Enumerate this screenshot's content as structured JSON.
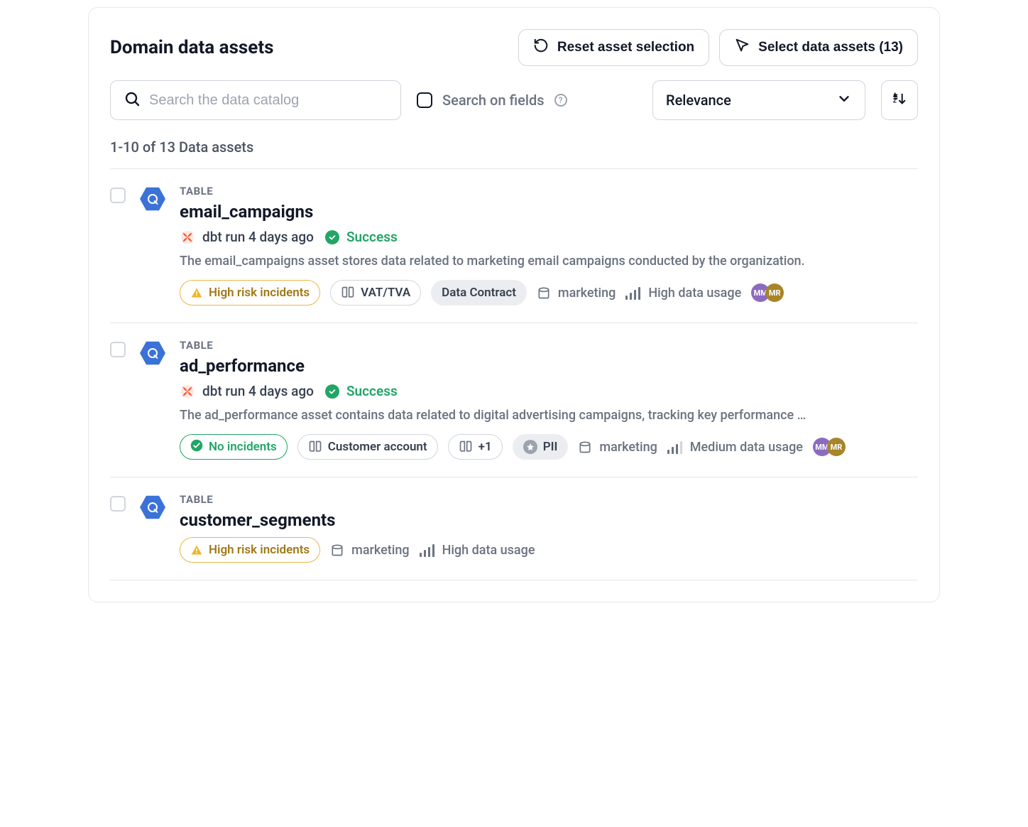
{
  "header": {
    "title": "Domain data assets",
    "reset_button": "Reset asset selection",
    "select_button": "Select data assets (13)"
  },
  "controls": {
    "search_placeholder": "Search the data catalog",
    "search_on_fields": "Search on fields",
    "sort_value": "Relevance"
  },
  "count_label": "1-10 of 13 Data assets",
  "avatars": {
    "mm": "MM",
    "mr": "MR"
  },
  "items": [
    {
      "type": "TABLE",
      "name": "email_campaigns",
      "run_text": "dbt run 4 days ago",
      "status": "Success",
      "description": "The email_campaigns asset stores data related to marketing email campaigns conducted by the organization.",
      "incident_label": "High risk incidents",
      "incident_kind": "warn",
      "term_pills": [
        "VAT/TVA"
      ],
      "extra_term": "",
      "contract_pills": [
        "Data Contract"
      ],
      "domain": "marketing",
      "usage": "High data usage",
      "usage_level": "high",
      "show_run": true,
      "show_avatars": true
    },
    {
      "type": "TABLE",
      "name": "ad_performance",
      "run_text": "dbt run 4 days ago",
      "status": "Success",
      "description": "The ad_performance asset contains data related to digital advertising campaigns, tracking key performance …",
      "incident_label": "No incidents",
      "incident_kind": "ok",
      "term_pills": [
        "Customer account"
      ],
      "extra_term": "+1",
      "contract_pills": [
        "PII"
      ],
      "domain": "marketing",
      "usage": "Medium data usage",
      "usage_level": "medium",
      "show_run": true,
      "show_avatars": true
    },
    {
      "type": "TABLE",
      "name": "customer_segments",
      "run_text": "",
      "status": "",
      "description": "",
      "incident_label": "High risk incidents",
      "incident_kind": "warn",
      "term_pills": [],
      "extra_term": "",
      "contract_pills": [],
      "domain": "marketing",
      "usage": "High data usage",
      "usage_level": "high",
      "show_run": false,
      "show_avatars": false
    }
  ]
}
